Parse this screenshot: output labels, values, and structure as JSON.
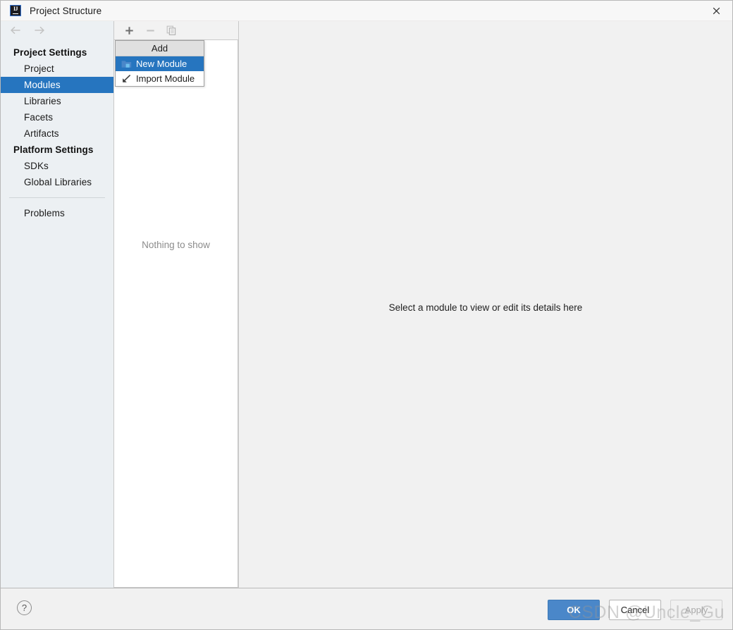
{
  "window": {
    "title": "Project Structure",
    "app_icon": "intellij-idea-icon",
    "close_icon": "close-icon"
  },
  "navigation": {
    "back_icon": "arrow-left-icon",
    "forward_icon": "arrow-right-icon"
  },
  "sidebar": {
    "groups": [
      {
        "label": "Project Settings",
        "items": [
          {
            "label": "Project",
            "selected": false
          },
          {
            "label": "Modules",
            "selected": true
          },
          {
            "label": "Libraries",
            "selected": false
          },
          {
            "label": "Facets",
            "selected": false
          },
          {
            "label": "Artifacts",
            "selected": false
          }
        ]
      },
      {
        "label": "Platform Settings",
        "items": [
          {
            "label": "SDKs",
            "selected": false
          },
          {
            "label": "Global Libraries",
            "selected": false
          }
        ]
      }
    ],
    "extra_items": [
      {
        "label": "Problems",
        "selected": false
      }
    ]
  },
  "middle_panel": {
    "toolbar": [
      {
        "name": "add-button",
        "icon": "plus-icon",
        "enabled": true
      },
      {
        "name": "remove-button",
        "icon": "minus-icon",
        "enabled": false
      },
      {
        "name": "copy-button",
        "icon": "copy-icon",
        "enabled": false
      }
    ],
    "empty_text": "Nothing to show"
  },
  "add_menu": {
    "title": "Add",
    "items": [
      {
        "label": "New Module",
        "icon": "new-module-folder-icon",
        "highlighted": true
      },
      {
        "label": "Import Module",
        "icon": "import-arrow-icon",
        "highlighted": false
      }
    ]
  },
  "detail_panel": {
    "message": "Select a module to view or edit its details here"
  },
  "footer": {
    "help_label": "?",
    "buttons": [
      {
        "name": "ok-button",
        "label": "OK",
        "style": "primary"
      },
      {
        "name": "cancel-button",
        "label": "Cancel",
        "style": "normal"
      },
      {
        "name": "apply-button",
        "label": "Apply",
        "style": "disabled"
      }
    ]
  },
  "watermark": {
    "text": "CSDN @Uncle_Gu"
  },
  "colors": {
    "accent_blue": "#2675bf",
    "primary_button": "#4a87c9",
    "sidebar_bg": "#ecf0f3",
    "panel_bg": "#f1f1f1"
  }
}
